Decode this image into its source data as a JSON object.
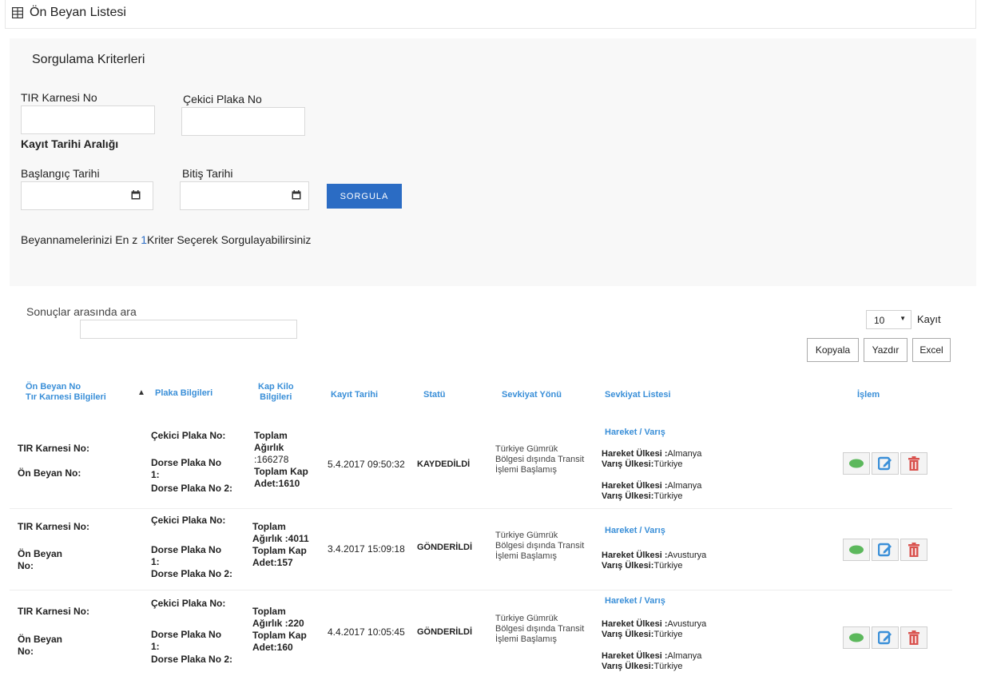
{
  "page": {
    "title": "Ön Beyan Listesi"
  },
  "criteria": {
    "title": "Sorgulama Kriterleri",
    "tir_karnesi_label": "TIR Karnesi No",
    "tir_karnesi_value": "",
    "cekici_plaka_label": "Çekici Plaka No",
    "cekici_plaka_value": "",
    "kayit_tarihi_label": "Kayıt Tarihi Aralığı",
    "baslangic_label": "Başlangıç Tarihi",
    "baslangic_value": "",
    "bitis_label": "Bitiş Tarihi",
    "bitis_value": "",
    "sorgula_label": "SORGULA",
    "hint_before": "Beyannamelerinizi En z ",
    "hint_num": "1",
    "hint_after": "Kriter Seçerek Sorgulayabilirsiniz"
  },
  "results": {
    "search_label": "Sonuçlar arasında ara",
    "search_value": "",
    "page_size": "10",
    "page_size_suffix": "Kayıt",
    "copy_label": "Kopyala",
    "print_label": "Yazdır",
    "excel_label": "Excel"
  },
  "table": {
    "headers": {
      "onbeyan_1": "Ön Beyan No",
      "onbeyan_2": "Tır Karnesi Bilgileri",
      "plaka": "Plaka Bilgileri",
      "kap_1": "Kap Kilo",
      "kap_2": "Bilgileri",
      "kayit": "Kayıt Tarihi",
      "statu": "Statü",
      "sevkiyat_yonu": "Sevkiyat Yönü",
      "sevkiyat_listesi": "Sevkiyat Listesi",
      "islem": "İşlem"
    },
    "rows": [
      {
        "tir_label": "TIR Karnesi No:",
        "onbeyan_label": "Ön Beyan No:",
        "cekici": "Çekici Plaka No:",
        "dorse1_a": "Dorse Plaka No",
        "dorse1_b": "1:",
        "dorse2": "Dorse Plaka No 2:",
        "kap_1": "Toplam",
        "kap_2": "Ağırlık",
        "kap_3": ":166278",
        "kap_4": "Toplam Kap",
        "kap_5": "Adet:1610",
        "tarih": "5.4.2017 09:50:32",
        "statu": "KAYDEDİLDİ",
        "yon_1": "Türkiye Gümrük",
        "yon_2": "Bölgesi dışında Transit",
        "yon_3": "İşlemi Başlamış",
        "hv_title": "Hareket / Varış",
        "hv_1_hareket": "Almanya",
        "hv_1_varis": "Türkiye",
        "hv_2_hareket": "Almanya",
        "hv_2_varis": "Türkiye"
      },
      {
        "tir_label": "TIR Karnesi No:",
        "onbeyan_label_1": "Ön Beyan",
        "onbeyan_label_2": "No:",
        "cekici": "Çekici Plaka No:",
        "dorse1_a": "Dorse Plaka No",
        "dorse1_b": "1:",
        "dorse2": "Dorse Plaka No 2:",
        "kap_1": "Toplam",
        "kap_2": "Ağırlık :4011",
        "kap_3": "Toplam Kap",
        "kap_4": "Adet:157",
        "tarih": "3.4.2017 15:09:18",
        "statu": "GÖNDERİLDİ",
        "yon_1": "Türkiye Gümrük",
        "yon_2": "Bölgesi dışında Transit",
        "yon_3": "İşlemi Başlamış",
        "hv_title": "Hareket / Varış",
        "hv_1_hareket": "Avusturya",
        "hv_1_varis": "Türkiye"
      },
      {
        "tir_label": "TIR Karnesi No:",
        "onbeyan_label_1": "Ön Beyan",
        "onbeyan_label_2": "No:",
        "cekici": "Çekici Plaka No:",
        "dorse1_a": "Dorse Plaka No",
        "dorse1_b": "1:",
        "dorse2": "Dorse Plaka No 2:",
        "kap_1": "Toplam",
        "kap_2": "Ağırlık :220",
        "kap_3": "Toplam Kap",
        "kap_4": "Adet:160",
        "tarih": "4.4.2017 10:05:45",
        "statu": "GÖNDERİLDİ",
        "yon_1": "Türkiye Gümrük",
        "yon_2": "Bölgesi dışında Transit",
        "yon_3": "İşlemi Başlamış",
        "hv_title": "Hareket / Varış",
        "hv_1_hareket": "Avusturya",
        "hv_1_varis": "Türkiye",
        "hv_2_hareket": "Almanya",
        "hv_2_varis": "Türkiye"
      }
    ],
    "hareket_prefix": "Hareket Ülkesi :",
    "varis_prefix": "Varış Ülkesi:"
  },
  "icons": {
    "title_icon": "table-icon",
    "calendar": "calendar-icon",
    "view": "eye-icon",
    "edit": "edit-icon",
    "delete": "trash-icon"
  },
  "colors": {
    "accent": "#2b6cc4",
    "header_blue": "#3a8fd8",
    "view_green": "#5cb85c",
    "edit_blue": "#3a8fd8",
    "delete_red": "#d9534f"
  }
}
